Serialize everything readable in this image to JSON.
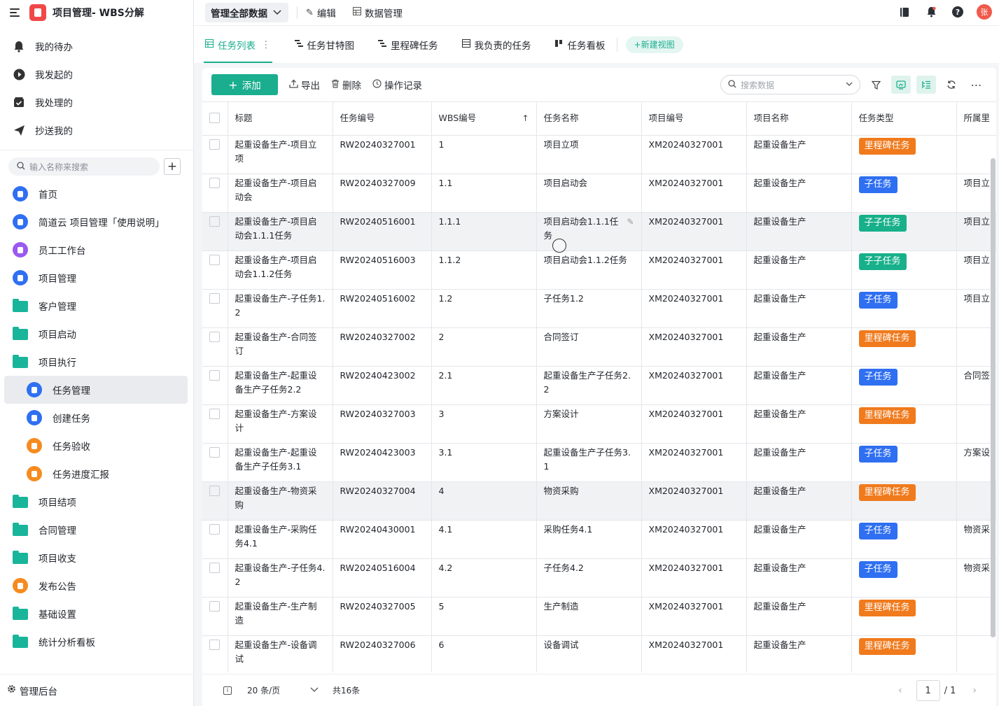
{
  "app": {
    "title": "项目管理- WBS分解"
  },
  "quick": [
    {
      "label": "我的待办",
      "icon": "bell-icon"
    },
    {
      "label": "我发起的",
      "icon": "play-icon"
    },
    {
      "label": "我处理的",
      "icon": "inbox-icon"
    },
    {
      "label": "抄送我的",
      "icon": "send-icon"
    }
  ],
  "sidebar_search": {
    "placeholder": "输入名称来搜索"
  },
  "nav": [
    {
      "label": "首页",
      "type": "circle",
      "color": "#2f6ff1"
    },
    {
      "label": "简道云 项目管理「使用说明」",
      "type": "circle",
      "color": "#2f6ff1"
    },
    {
      "label": "员工工作台",
      "type": "circle",
      "color": "#9b59f0"
    },
    {
      "label": "项目管理",
      "type": "circle",
      "color": "#2f6ff1"
    },
    {
      "label": "客户管理",
      "type": "folder"
    },
    {
      "label": "项目启动",
      "type": "folder"
    },
    {
      "label": "项目执行",
      "type": "folder"
    },
    {
      "label": "任务管理",
      "type": "circle",
      "color": "#2f6ff1",
      "sub": true,
      "active": true
    },
    {
      "label": "创建任务",
      "type": "circle",
      "color": "#2f6ff1",
      "sub": true
    },
    {
      "label": "任务验收",
      "type": "circle",
      "color": "#f58b1f",
      "sub": true
    },
    {
      "label": "任务进度汇报",
      "type": "circle",
      "color": "#f58b1f",
      "sub": true
    },
    {
      "label": "项目结项",
      "type": "folder"
    },
    {
      "label": "合同管理",
      "type": "folder"
    },
    {
      "label": "项目收支",
      "type": "folder"
    },
    {
      "label": "发布公告",
      "type": "circle",
      "color": "#f58b1f"
    },
    {
      "label": "基础设置",
      "type": "folder"
    },
    {
      "label": "统计分析看板",
      "type": "folder"
    }
  ],
  "footer": {
    "admin": "管理后台"
  },
  "topbar": {
    "scope": "管理全部数据",
    "edit": "编辑",
    "data_manage": "数据管理",
    "avatar": "张"
  },
  "tabs": [
    {
      "label": "任务列表",
      "active": true
    },
    {
      "label": "任务甘特图"
    },
    {
      "label": "里程碑任务"
    },
    {
      "label": "我负责的任务"
    },
    {
      "label": "任务看板"
    }
  ],
  "new_view": "新建视图",
  "toolbar": {
    "add": "添加",
    "export": "导出",
    "delete": "删除",
    "log": "操作记录",
    "search_placeholder": "搜索数据"
  },
  "columns": [
    "标题",
    "任务编号",
    "WBS编号",
    "任务名称",
    "项目编号",
    "项目名称",
    "任务类型",
    "所属里"
  ],
  "tag_colors": {
    "里程碑任务": "#f07a1c",
    "子任务": "#2f6ff1",
    "子子任务": "#17b08a"
  },
  "rows": [
    {
      "title": "起重设备生产-项目立项",
      "task_no": "RW20240327001",
      "wbs": "1",
      "name": "项目立项",
      "proj_no": "XM20240327001",
      "proj_name": "起重设备生产",
      "type": "里程碑任务",
      "parent": ""
    },
    {
      "title": "起重设备生产-项目启动会",
      "task_no": "RW20240327009",
      "wbs": "1.1",
      "name": "项目启动会",
      "proj_no": "XM20240327001",
      "proj_name": "起重设备生产",
      "type": "子任务",
      "parent": "项目立"
    },
    {
      "title": "起重设备生产-项目启动会1.1.1任务",
      "task_no": "RW20240516001",
      "wbs": "1.1.1",
      "name": "项目启动会1.1.1任务",
      "proj_no": "XM20240327001",
      "proj_name": "起重设备生产",
      "type": "子子任务",
      "parent": "项目立",
      "highlight": true
    },
    {
      "title": "起重设备生产-项目启动会1.1.2任务",
      "task_no": "RW20240516003",
      "wbs": "1.1.2",
      "name": "项目启动会1.1.2任务",
      "proj_no": "XM20240327001",
      "proj_name": "起重设备生产",
      "type": "子子任务",
      "parent": "项目立"
    },
    {
      "title": "起重设备生产-子任务1.2",
      "task_no": "RW20240516002",
      "wbs": "1.2",
      "name": "子任务1.2",
      "proj_no": "XM20240327001",
      "proj_name": "起重设备生产",
      "type": "子任务",
      "parent": "项目立"
    },
    {
      "title": "起重设备生产-合同签订",
      "task_no": "RW20240327002",
      "wbs": "2",
      "name": "合同签订",
      "proj_no": "XM20240327001",
      "proj_name": "起重设备生产",
      "type": "里程碑任务",
      "parent": ""
    },
    {
      "title": "起重设备生产-起重设备生产子任务2.2",
      "task_no": "RW20240423002",
      "wbs": "2.1",
      "name": "起重设备生产子任务2.2",
      "proj_no": "XM20240327001",
      "proj_name": "起重设备生产",
      "type": "子任务",
      "parent": "合同签"
    },
    {
      "title": "起重设备生产-方案设计",
      "task_no": "RW20240327003",
      "wbs": "3",
      "name": "方案设计",
      "proj_no": "XM20240327001",
      "proj_name": "起重设备生产",
      "type": "里程碑任务",
      "parent": ""
    },
    {
      "title": "起重设备生产-起重设备生产子任务3.1",
      "task_no": "RW20240423003",
      "wbs": "3.1",
      "name": "起重设备生产子任务3.1",
      "proj_no": "XM20240327001",
      "proj_name": "起重设备生产",
      "type": "子任务",
      "parent": "方案设"
    },
    {
      "title": "起重设备生产-物资采购",
      "task_no": "RW20240327004",
      "wbs": "4",
      "name": "物资采购",
      "proj_no": "XM20240327001",
      "proj_name": "起重设备生产",
      "type": "里程碑任务",
      "parent": "",
      "highlight": true
    },
    {
      "title": "起重设备生产-采购任务4.1",
      "task_no": "RW20240430001",
      "wbs": "4.1",
      "name": "采购任务4.1",
      "proj_no": "XM20240327001",
      "proj_name": "起重设备生产",
      "type": "子任务",
      "parent": "物资采"
    },
    {
      "title": "起重设备生产-子任务4.2",
      "task_no": "RW20240516004",
      "wbs": "4.2",
      "name": "子任务4.2",
      "proj_no": "XM20240327001",
      "proj_name": "起重设备生产",
      "type": "子任务",
      "parent": "物资采"
    },
    {
      "title": "起重设备生产-生产制造",
      "task_no": "RW20240327005",
      "wbs": "5",
      "name": "生产制造",
      "proj_no": "XM20240327001",
      "proj_name": "起重设备生产",
      "type": "里程碑任务",
      "parent": ""
    },
    {
      "title": "起重设备生产-设备调试",
      "task_no": "RW20240327006",
      "wbs": "6",
      "name": "设备调试",
      "proj_no": "XM20240327001",
      "proj_name": "起重设备生产",
      "type": "里程碑任务",
      "parent": ""
    }
  ],
  "pager": {
    "page_size": "20 条/页",
    "total": "共16条",
    "page": "1",
    "pages": "/ 1"
  }
}
